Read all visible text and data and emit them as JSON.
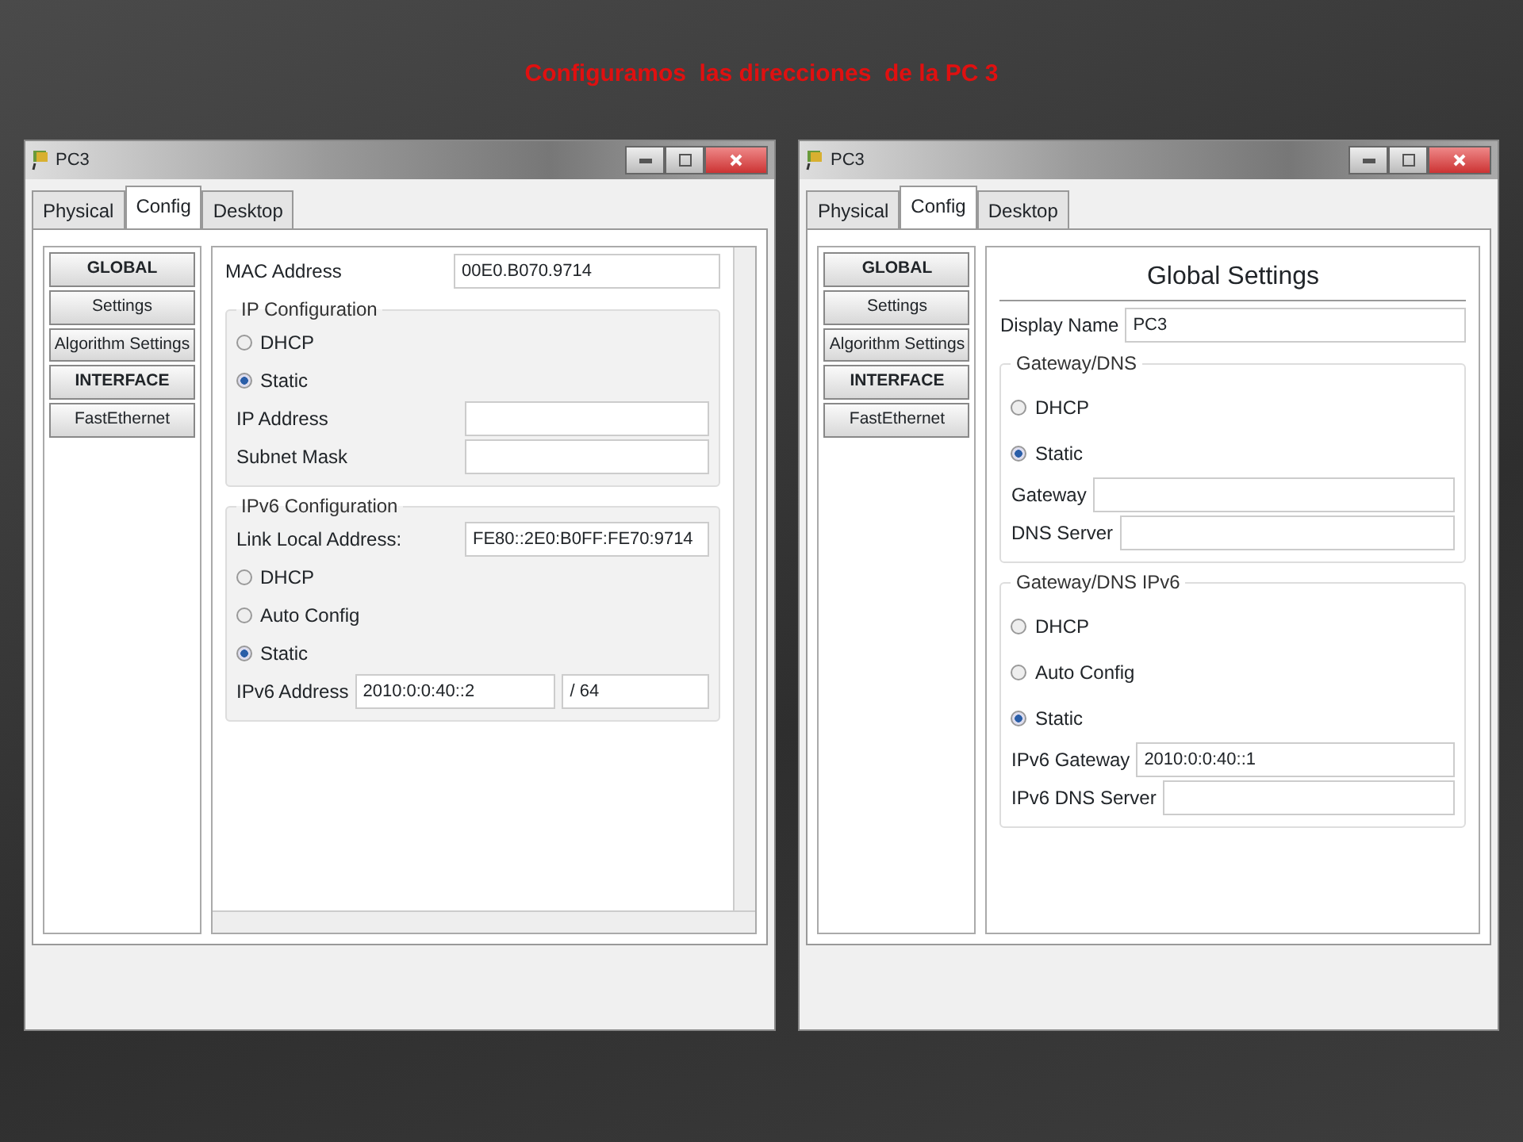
{
  "slide_title": "Configuramos  las direcciones  de la PC 3",
  "windows": [
    {
      "title": "PC3",
      "tabs": [
        {
          "label": "Physical",
          "selected": false
        },
        {
          "label": "Config",
          "selected": true
        },
        {
          "label": "Desktop",
          "selected": false
        }
      ],
      "sidebar": [
        {
          "label": "GLOBAL",
          "kind": "header"
        },
        {
          "label": "Settings",
          "kind": "item"
        },
        {
          "label": "Algorithm Settings",
          "kind": "item"
        },
        {
          "label": "INTERFACE",
          "kind": "header"
        },
        {
          "label": "FastEthernet",
          "kind": "item"
        }
      ],
      "panel": {
        "scrollbars": true,
        "rows": [
          {
            "kind": "field",
            "label": "MAC Address",
            "value": "00E0.B070.9714"
          },
          {
            "kind": "section",
            "label": "IP Configuration",
            "rows": [
              {
                "kind": "radio",
                "label": "DHCP",
                "selected": false
              },
              {
                "kind": "radio",
                "label": "Static",
                "selected": true
              },
              {
                "kind": "field",
                "label": "IP Address"
              },
              {
                "kind": "field",
                "label": "Subnet Mask"
              }
            ]
          },
          {
            "kind": "section",
            "label": "IPv6 Configuration",
            "rows": [
              {
                "kind": "field",
                "label": "Link Local Address:",
                "value": "FE80::2E0:B0FF:FE70:9714"
              },
              {
                "kind": "radio",
                "label": "DHCP",
                "selected": false
              },
              {
                "kind": "radio",
                "label": "Auto Config",
                "selected": false
              },
              {
                "kind": "radio",
                "label": "Static",
                "selected": true
              },
              {
                "kind": "prefix",
                "label": "IPv6 Address",
                "value": "2010:0:0:40::2",
                "separator": "/",
                "prefix": "64"
              }
            ]
          }
        ]
      }
    },
    {
      "title": "PC3",
      "tabs": [
        {
          "label": "Physical",
          "selected": false
        },
        {
          "label": "Config",
          "selected": true
        },
        {
          "label": "Desktop",
          "selected": false
        }
      ],
      "sidebar": [
        {
          "label": "GLOBAL",
          "kind": "header"
        },
        {
          "label": "Settings",
          "kind": "item"
        },
        {
          "label": "Algorithm Settings",
          "kind": "item"
        },
        {
          "label": "INTERFACE",
          "kind": "header"
        },
        {
          "label": "FastEthernet",
          "kind": "item"
        }
      ],
      "panel": {
        "scrollbars": false,
        "rows": [
          {
            "kind": "heading",
            "label": "Global Settings"
          },
          {
            "kind": "field",
            "label": "Display Name",
            "value": "PC3"
          },
          {
            "kind": "section",
            "label": "Gateway/DNS",
            "rows": [
              {
                "kind": "radio",
                "label": "DHCP",
                "selected": false
              },
              {
                "kind": "radio",
                "label": "Static",
                "selected": true
              },
              {
                "kind": "field",
                "label": "Gateway"
              },
              {
                "kind": "field",
                "label": "DNS Server"
              }
            ]
          },
          {
            "kind": "section",
            "label": "Gateway/DNS IPv6",
            "rows": [
              {
                "kind": "radio",
                "label": "DHCP",
                "selected": false
              },
              {
                "kind": "radio",
                "label": "Auto Config",
                "selected": false
              },
              {
                "kind": "radio",
                "label": "Static",
                "selected": true
              },
              {
                "kind": "field",
                "label": "IPv6 Gateway",
                "value": "2010:0:0:40::1"
              },
              {
                "kind": "field",
                "label": "IPv6 DNS Server"
              }
            ]
          }
        ]
      }
    }
  ]
}
